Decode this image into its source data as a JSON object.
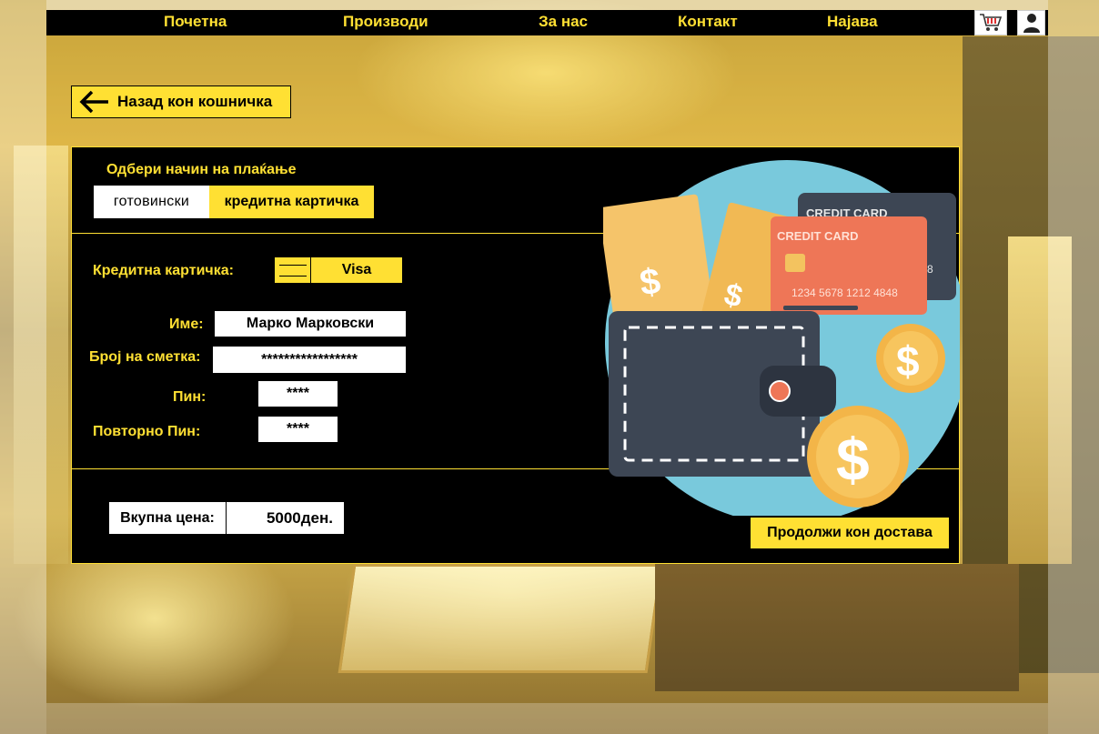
{
  "nav": {
    "home": "Почетна",
    "products": "Производи",
    "about": "За нас",
    "contact": "Контакт",
    "login": "Најава",
    "cart_icon": "shopping-cart-icon",
    "user_icon": "user-icon"
  },
  "back_button": {
    "label": "Назад кон кошничка",
    "icon": "arrow-left-icon"
  },
  "payment": {
    "title": "Одбери начин на плаќање",
    "method_cash": "готовински",
    "method_card": "кредитна картичка",
    "selected_method": "кредитна картичка"
  },
  "form": {
    "card_label": "Кредитна картичка:",
    "card_type": "Visa",
    "name_label": "Име:",
    "name_value": "Марко Марковски",
    "account_label": "Број на сметка:",
    "account_value": "*****************",
    "pin_label": "Пин:",
    "pin_value": "****",
    "pin_repeat_label": "Повторно Пин:",
    "pin_repeat_value": "****"
  },
  "illustration": {
    "card_back_text": "CREDIT CARD",
    "card_front_text": "CREDIT CARD",
    "card_number": "1234  5678 1212 4848",
    "card_back_digit": "8"
  },
  "summary": {
    "total_label": "Вкупна цена:",
    "total_value": "5000ден.",
    "continue_label": "Продолжи кон достава"
  },
  "colors": {
    "accent": "#ffe033",
    "panel": "#000000"
  }
}
